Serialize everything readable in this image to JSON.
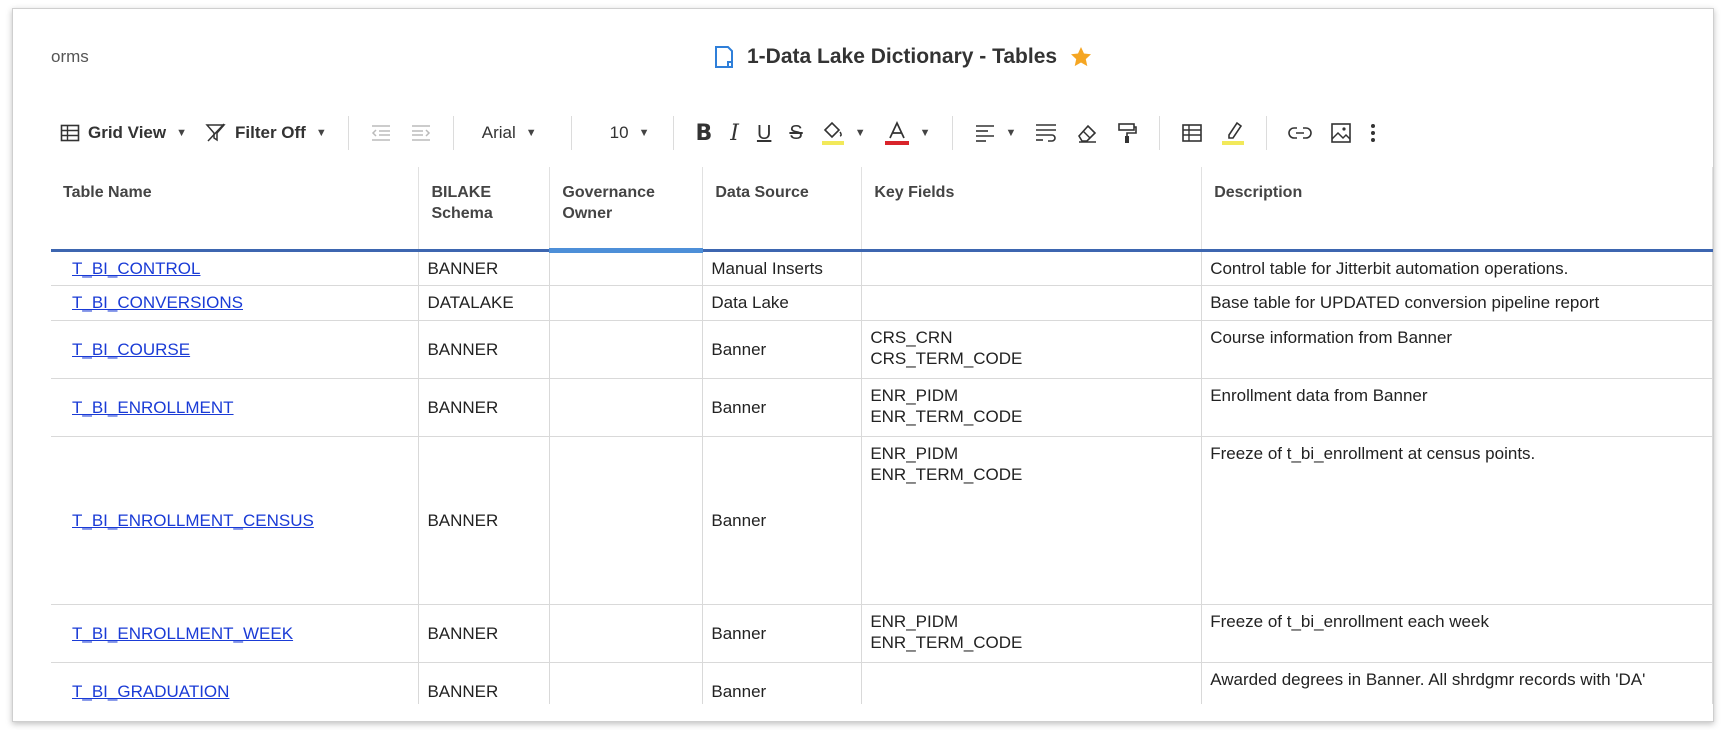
{
  "header": {
    "forms_label": "orms",
    "doc_title": "1-Data Lake Dictionary - Tables",
    "doc_icon": "sheet-icon",
    "favorite_icon": "star-icon",
    "accent_color": "#f5a623"
  },
  "toolbar": {
    "view_label": "Grid View",
    "filter_label": "Filter Off",
    "font_family": "Arial",
    "font_size": "10"
  },
  "table": {
    "columns": [
      "Table Name",
      "BILAKE Schema",
      "Governance Owner",
      "Data Source",
      "Key Fields",
      "Description"
    ],
    "rows": [
      {
        "name": "T_BI_CONTROL",
        "schema": "BANNER",
        "owner": "",
        "source": "Manual Inserts",
        "keys": "",
        "description": "Control table for Jitterbit automation operations."
      },
      {
        "name": "T_BI_CONVERSIONS",
        "schema": "DATALAKE",
        "owner": "",
        "source": "Data Lake",
        "keys": "",
        "description": "Base table for UPDATED conversion pipeline report"
      },
      {
        "name": "T_BI_COURSE",
        "schema": "BANNER",
        "owner": "",
        "source": "Banner",
        "keys": "CRS_CRN\nCRS_TERM_CODE",
        "description": "Course information from Banner"
      },
      {
        "name": "T_BI_ENROLLMENT",
        "schema": "BANNER",
        "owner": "",
        "source": "Banner",
        "keys": "ENR_PIDM\nENR_TERM_CODE",
        "description": "Enrollment data from Banner"
      },
      {
        "name": "T_BI_ENROLLMENT_CENSUS",
        "schema": "BANNER",
        "owner": "",
        "source": "Banner",
        "keys": "ENR_PIDM\nENR_TERM_CODE",
        "description": "Freeze of t_bi_enrollment at census points."
      },
      {
        "name": "T_BI_ENROLLMENT_WEEK",
        "schema": "BANNER",
        "owner": "",
        "source": "Banner",
        "keys": "ENR_PIDM\nENR_TERM_CODE",
        "description": "Freeze of t_bi_enrollment each week"
      },
      {
        "name": "T_BI_GRADUATION",
        "schema": "BANNER",
        "owner": "",
        "source": "Banner",
        "keys": "",
        "description": "Awarded degrees in Banner. All shrdgmr records with 'DA'"
      }
    ]
  }
}
